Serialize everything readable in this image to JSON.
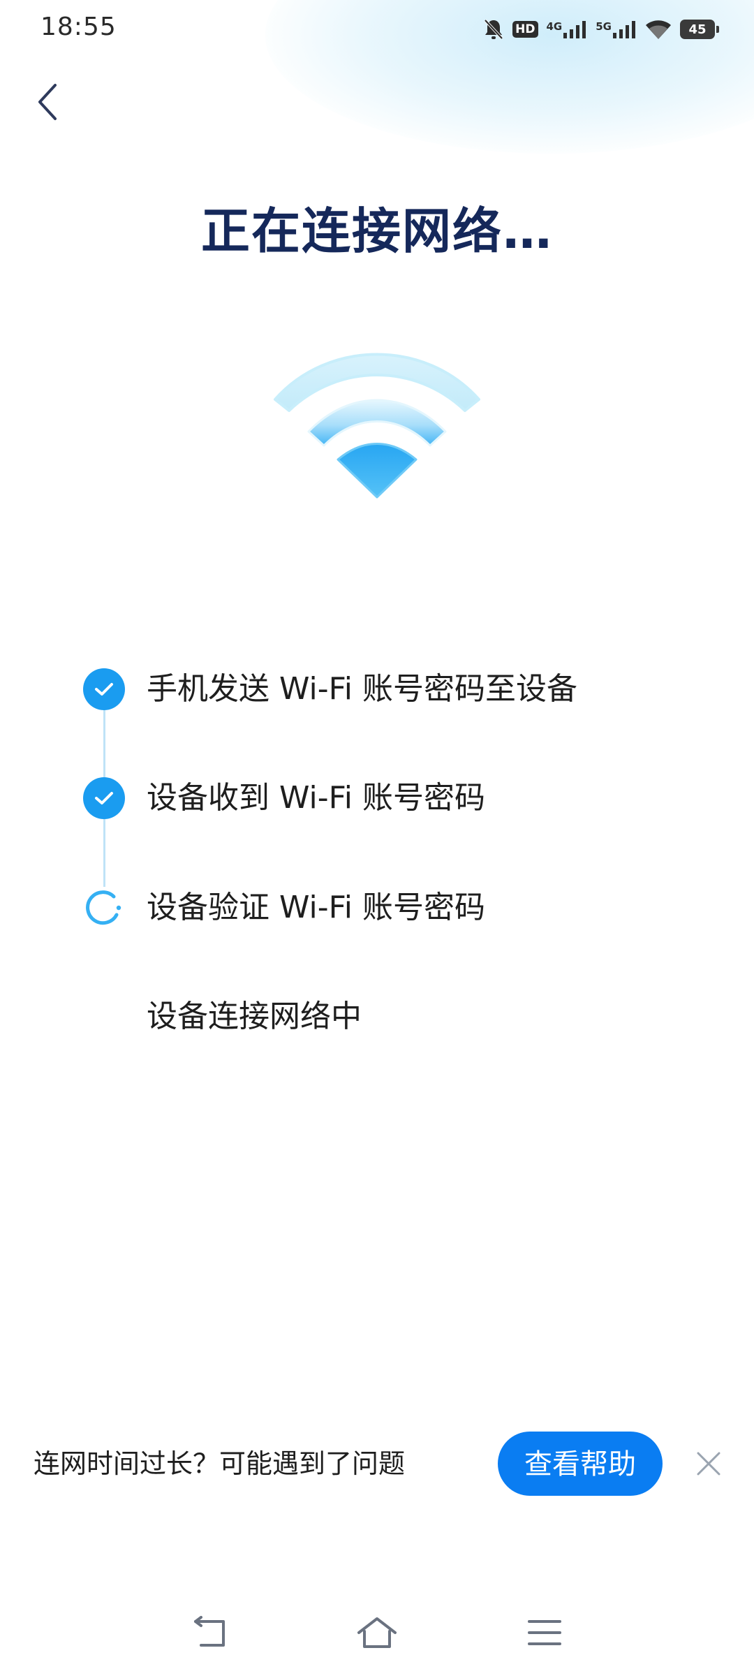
{
  "status_bar": {
    "time": "18:55",
    "hd_label": "HD",
    "network_1": "4G",
    "network_2": "5G",
    "battery_level": "45"
  },
  "header": {
    "title": "正在连接网络…"
  },
  "steps": [
    {
      "label": "手机发送 Wi-Fi 账号密码至设备",
      "state": "done"
    },
    {
      "label": "设备收到 Wi-Fi 账号密码",
      "state": "done"
    },
    {
      "label": "设备验证 Wi-Fi 账号密码",
      "state": "in_progress"
    },
    {
      "label": "设备连接网络中",
      "state": "pending"
    }
  ],
  "notice": {
    "text": "连网时间过长？可能遇到了问题",
    "help_button": "查看帮助"
  },
  "colors": {
    "accent": "#0a7df2",
    "step_done": "#1a9cf0",
    "title": "#15285a",
    "line": "#bfe3f7"
  },
  "icons": {
    "back": "chevron-left-icon",
    "wifi": "wifi-illustration",
    "close": "close-icon",
    "nav_back": "nav-back-icon",
    "nav_home": "nav-home-icon",
    "nav_menu": "nav-menu-icon"
  }
}
